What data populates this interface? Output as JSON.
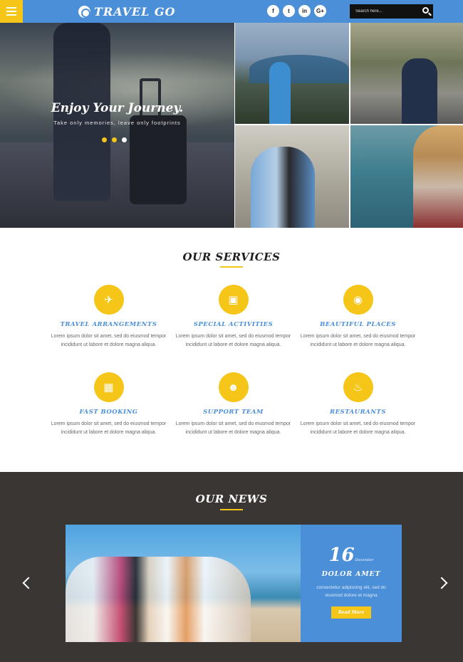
{
  "header": {
    "brand": "TRAVEL GO",
    "socials": [
      {
        "icon": "facebook-icon",
        "glyph": "f"
      },
      {
        "icon": "twitter-icon",
        "glyph": "t"
      },
      {
        "icon": "linkedin-icon",
        "glyph": "in"
      },
      {
        "icon": "google-plus-icon",
        "glyph": "G+"
      }
    ],
    "search_placeholder": "Search here...",
    "colors": {
      "bar": "#4a8fd8",
      "menu": "#f5c518"
    }
  },
  "hero": {
    "title": "Enjoy Your Journey.",
    "subtitle": "Take only memories, leave only footprints"
  },
  "services": {
    "title": "OUR SERVICES",
    "items": [
      {
        "name": "TRAVEL ARRANGEMENTS",
        "icon": "airplane-icon",
        "glyph": "✈",
        "desc": "Lorem ipsum dolor sit amet, sed do eiusmod tempor incididunt ut labore et dolore magna aliqua."
      },
      {
        "name": "SPECIAL ACTIVITIES",
        "icon": "briefcase-icon",
        "glyph": "▣",
        "desc": "Lorem ipsum dolor sit amet, sed do eiusmod tempor incididunt ut labore et dolore magna aliqua."
      },
      {
        "name": "BEAUTIFUL PLACES",
        "icon": "globe-icon",
        "glyph": "◉",
        "desc": "Lorem ipsum dolor sit amet, sed do eiusmod tempor incididunt ut labore et dolore magna aliqua."
      },
      {
        "name": "FAST BOOKING",
        "icon": "calendar-icon",
        "glyph": "▦",
        "desc": "Lorem ipsum dolor sit amet, sed do eiusmod tempor incididunt ut labore et dolore magna aliqua."
      },
      {
        "name": "SUPPORT TEAM",
        "icon": "team-icon",
        "glyph": "☻",
        "desc": "Lorem ipsum dolor sit amet, sed do eiusmod tempor incididunt ut labore et dolore magna aliqua."
      },
      {
        "name": "RESTAURANTS",
        "icon": "cutlery-icon",
        "glyph": "♨",
        "desc": "Lorem ipsum dolor sit amet, sed do eiusmod tempor incididunt ut labore et dolore magna aliqua."
      }
    ]
  },
  "news": {
    "title": "OUR NEWS",
    "day": "16",
    "month": "December",
    "headline": "DOLOR AMET",
    "text": "consectetur adipiscing elit, sed do eiusmod dolore et magna",
    "read_more": "Read More"
  }
}
